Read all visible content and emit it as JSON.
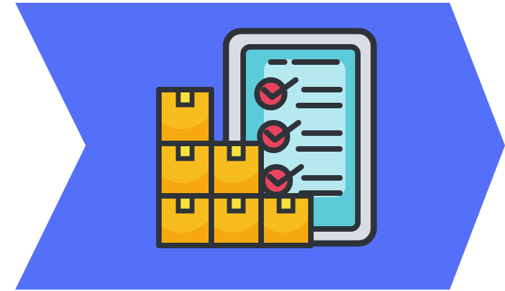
{
  "colors": {
    "background": "#ffffff",
    "chevron": "#5470f9",
    "outline": "#2e3339",
    "clipboard_frame": "#d9dde3",
    "clipboard_screen": "#5ccbd9",
    "clipboard_screen_light": "#b5e8ef",
    "check_circle": "#e8445f",
    "box_main": "#f7bd1c",
    "box_shade": "#f6a90f",
    "box_tape": "#f9e23c"
  },
  "illustration": {
    "icon": "inventory-checklist-icon",
    "checklist_items": 3,
    "box_count": 6
  }
}
